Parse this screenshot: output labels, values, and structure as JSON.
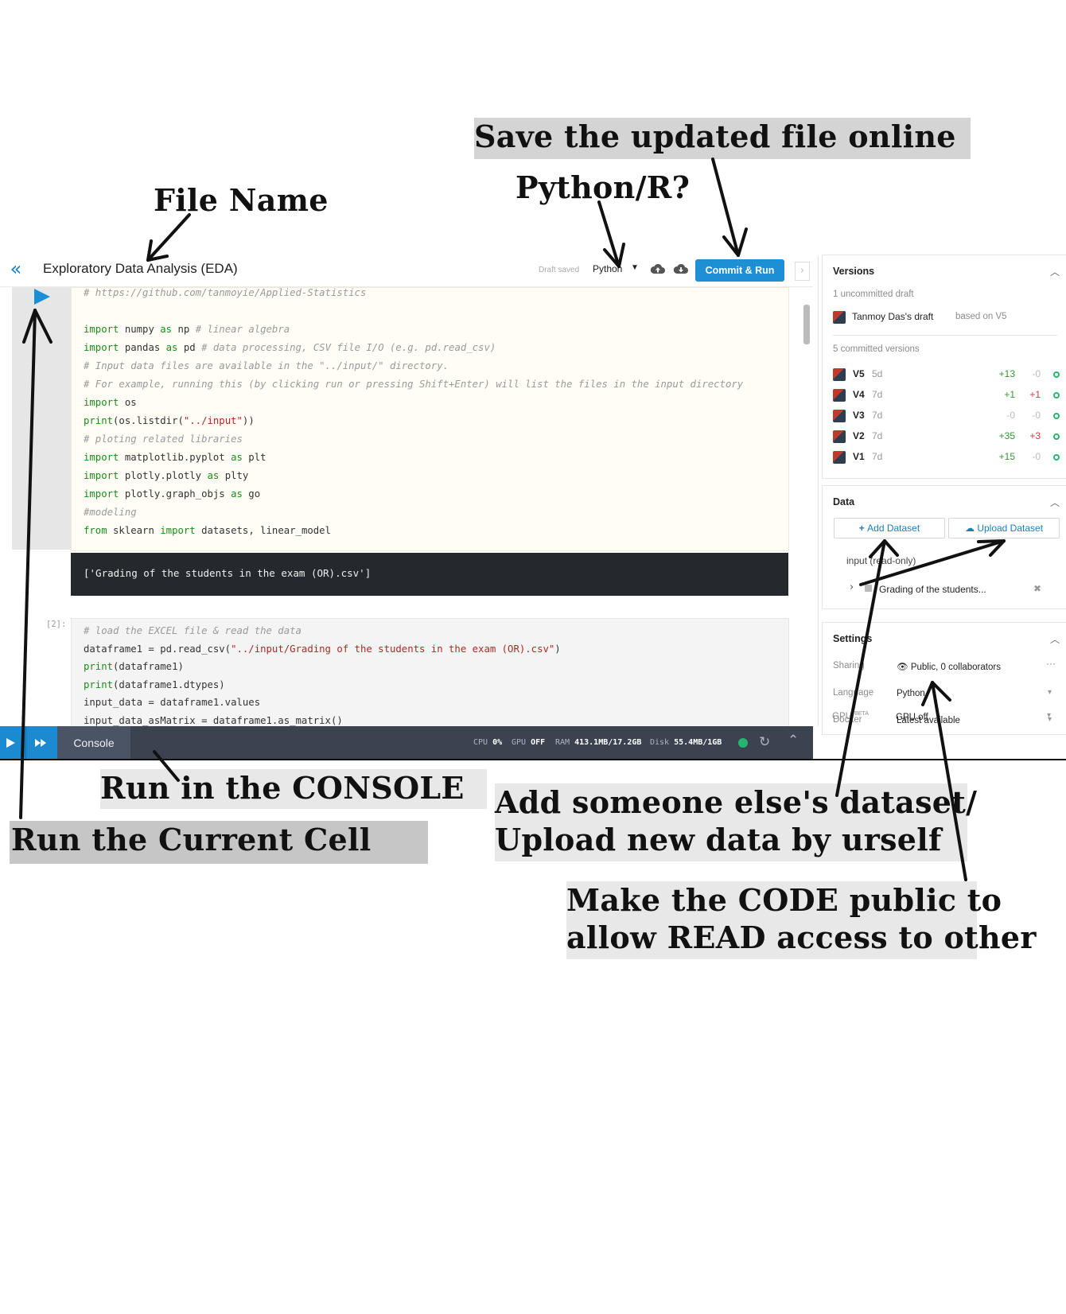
{
  "annotations": {
    "save_online": "Save the updated file online",
    "python_r": "Python/R?",
    "file_name": "File Name",
    "run_console": "Run in the CONSOLE",
    "run_cell": "Run the Current Cell",
    "add_dataset_line1": "Add someone else's dataset/",
    "add_dataset_line2": "Upload new data by urself",
    "public_line1": "Make the CODE public to",
    "public_line2": "allow READ access to other"
  },
  "header": {
    "title": "Exploratory Data Analysis (EDA)",
    "draft_status": "Draft saved",
    "language": "Python",
    "commit_label": "Commit & Run"
  },
  "cell1": {
    "lines": [
      "# https://github.com/tanmoyie/Applied-Statistics",
      "",
      "import numpy as np # linear algebra",
      "import pandas as pd # data processing, CSV file I/O (e.g. pd.read_csv)",
      "# Input data files are available in the \"../input/\" directory.",
      "# For example, running this (by clicking run or pressing Shift+Enter) will list the files in the input directory",
      "import os",
      "print(os.listdir(\"../input\"))",
      "# ploting related libraries",
      "import matplotlib.pyplot as plt",
      "import plotly.plotly as plty",
      "import plotly.graph_objs as go",
      "#modeling",
      "from sklearn import datasets, linear_model"
    ],
    "output": "['Grading of the students in the exam (OR).csv']"
  },
  "cell2": {
    "exec_count": "[2]:",
    "lines": [
      "# load the EXCEL file & read the data",
      "dataframe1 = pd.read_csv(\"../input/Grading of the students in the exam (OR).csv\")",
      "print(dataframe1)",
      "print(dataframe1.dtypes)",
      "input_data = dataframe1.values",
      "input_data_asMatrix = dataframe1.as_matrix()"
    ]
  },
  "console": {
    "tab_label": "Console",
    "cpu_label": "CPU",
    "cpu_value": "0%",
    "gpu_label": "GPU",
    "gpu_value": "OFF",
    "ram_label": "RAM",
    "ram_value": "413.1MB/17.2GB",
    "disk_label": "Disk",
    "disk_value": "55.4MB/1GB"
  },
  "versions": {
    "title": "Versions",
    "uncommitted": "1 uncommitted draft",
    "draft_owner": "Tanmoy Das's draft",
    "based_on": "based on V5",
    "committed": "5 committed versions",
    "rows": [
      {
        "name": "V5",
        "age": "5d",
        "add": "+13",
        "del": "-0",
        "del_color": "#bbbbbb"
      },
      {
        "name": "V4",
        "age": "7d",
        "add": "+1",
        "del": "+1",
        "del_color": "#d23b3b"
      },
      {
        "name": "V3",
        "age": "7d",
        "add": "-0",
        "del": "-0",
        "del_color": "#bbbbbb"
      },
      {
        "name": "V2",
        "age": "7d",
        "add": "+35",
        "del": "+3",
        "del_color": "#d23b3b"
      },
      {
        "name": "V1",
        "age": "7d",
        "add": "+15",
        "del": "-0",
        "del_color": "#bbbbbb"
      }
    ]
  },
  "data_panel": {
    "title": "Data",
    "add_dataset": "Add Dataset",
    "upload_dataset": "Upload Dataset",
    "input_label": "input (read-only)",
    "file_name": "Grading of the students..."
  },
  "settings": {
    "title": "Settings",
    "rows": [
      {
        "label": "Sharing",
        "value": "Public, 0 collaborators"
      },
      {
        "label": "Language",
        "value": "Python"
      },
      {
        "label": "Docker",
        "value": "Latest available"
      },
      {
        "label": "GPU",
        "value": "GPU off"
      }
    ],
    "gpu_badge": "BETA"
  }
}
